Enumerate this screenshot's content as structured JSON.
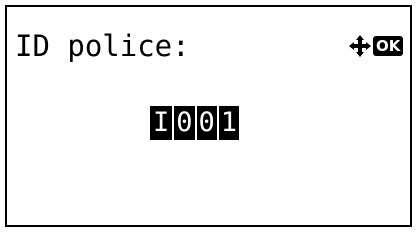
{
  "screen": {
    "title": "ID police:",
    "nav_hint": {
      "dpad_icon": "four-way-arrow-icon",
      "ok_label": "OK"
    },
    "input": {
      "prefix": "I",
      "digits": [
        "0",
        "0",
        "1"
      ]
    }
  },
  "colors": {
    "background": "#ffffff",
    "foreground": "#000000",
    "highlight": "#000000",
    "highlight_text": "#ffffff"
  }
}
